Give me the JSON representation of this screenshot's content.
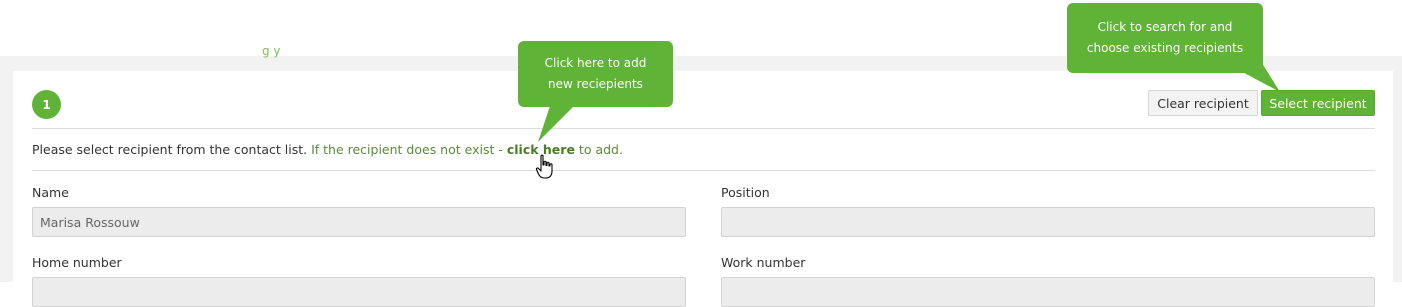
{
  "step": {
    "number": "1"
  },
  "buttons": {
    "clear_label": "Clear recipient",
    "select_label": "Select recipient"
  },
  "info": {
    "prefix": "Please select recipient from the contact list.",
    "middle": "If the recipient does not exist -",
    "link": "click here",
    "suffix": "to add."
  },
  "fields": {
    "name_label": "Name",
    "name_value": "Marisa Rossouw",
    "position_label": "Position",
    "position_value": "",
    "home_label": "Home number",
    "work_label": "Work number"
  },
  "tooltips": {
    "add_line1": "Click here to add",
    "add_line2": "new reciepients",
    "search_line1": "Click to search for and",
    "search_line2": "choose existing recipients"
  },
  "colors": {
    "accent_green": "#5fb336",
    "link_green": "#5c8a3a",
    "field_bg": "#ececec"
  }
}
